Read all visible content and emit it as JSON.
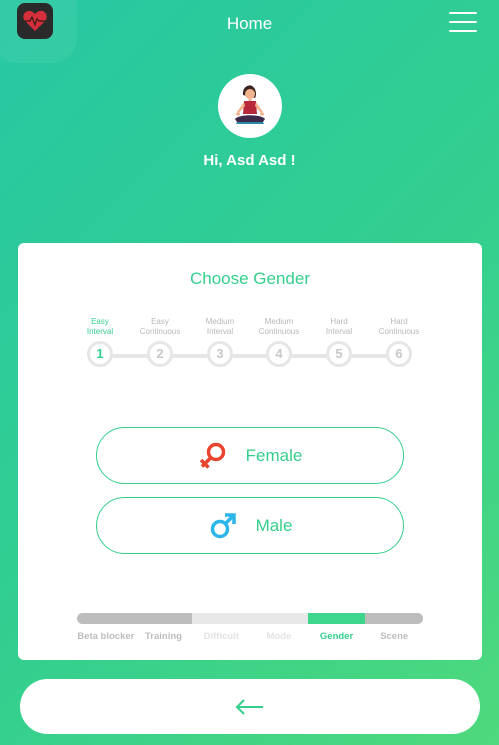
{
  "header": {
    "title": "Home",
    "app_icon": "heart-pulse-icon",
    "menu_icon": "hamburger-menu-icon"
  },
  "profile": {
    "avatar_icon": "yoga-person-avatar",
    "greeting": "Hi, Asd Asd  !"
  },
  "card": {
    "title": "Choose Gender",
    "steps": [
      {
        "number": "1",
        "label_line1": "Easy",
        "label_line2": "Interval"
      },
      {
        "number": "2",
        "label_line1": "Easy",
        "label_line2": "Continuous"
      },
      {
        "number": "3",
        "label_line1": "Medium",
        "label_line2": "Interval"
      },
      {
        "number": "4",
        "label_line1": "Medium",
        "label_line2": "Continuous"
      },
      {
        "number": "5",
        "label_line1": "Hard",
        "label_line2": "Interval"
      },
      {
        "number": "6",
        "label_line1": "Hard",
        "label_line2": "Continuous"
      }
    ],
    "active_step": 1,
    "options": [
      {
        "label": "Female",
        "icon": "female-symbol-icon",
        "color": "#e8442e"
      },
      {
        "label": "Male",
        "icon": "male-symbol-icon",
        "color": "#2bb5e8"
      }
    ],
    "progress": {
      "labels": [
        "Beta blocker",
        "Training",
        "Difficult",
        "Mode",
        "Gender",
        "Scene"
      ],
      "current": "Gender"
    }
  },
  "footer": {
    "back_icon": "arrow-left-icon"
  },
  "colors": {
    "accent": "#35cf8d",
    "background_start": "#27c7a3",
    "background_end": "#4fd97c"
  }
}
